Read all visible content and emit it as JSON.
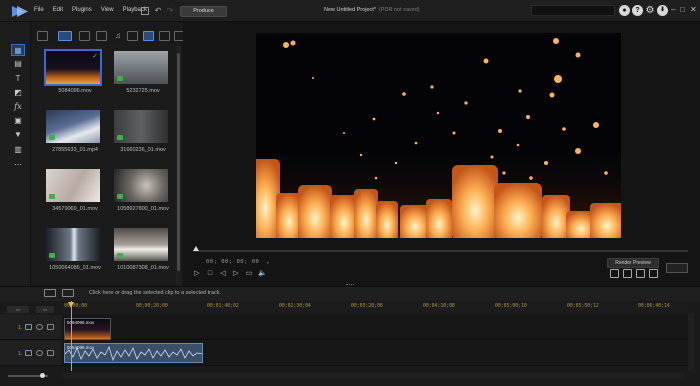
{
  "menu": [
    "File",
    "Edit",
    "Plugins",
    "View",
    "Playback"
  ],
  "toolbar": {
    "produce_label": "Produce",
    "undo_icon": "undo-icon",
    "redo_icon": "redo-icon"
  },
  "project": {
    "title": "New Untitled Project*",
    "status": "(PDR not saved)"
  },
  "header_icons": [
    "account-icon",
    "help-icon",
    "settings-icon",
    "update-icon"
  ],
  "window_controls": [
    "minimize",
    "maximize",
    "close"
  ],
  "tools": [
    "media-room-icon",
    "title-room-icon",
    "text-icon",
    "transition-icon",
    "fx-icon",
    "pip-icon",
    "particle-icon",
    "subtitle-icon",
    "more-icon"
  ],
  "library": {
    "items": [
      {
        "name": "5084096.mov",
        "selected": true
      },
      {
        "name": "5232725.mov"
      },
      {
        "name": "27855633_01.mp4"
      },
      {
        "name": "31660236_01.mov"
      },
      {
        "name": "34579069_01.mov"
      },
      {
        "name": "1058927800_01.mov"
      },
      {
        "name": "1050064086_01.mov"
      },
      {
        "name": "1010087308_01.mov"
      }
    ]
  },
  "preview": {
    "timecode": "00; 00; 00; 00",
    "timecode_mark": "⌄",
    "render_label": "Render Preview"
  },
  "timeline": {
    "hint": "Click here or drag the selected clip to a selected track.",
    "ruler": [
      "00;00;00",
      "00;00;20;00",
      "00;01;40;02",
      "00;02;30;04",
      "00;03;20;06",
      "00;04;10;08",
      "00;05;00;10",
      "00;05;50;12",
      "00;06;40;14"
    ],
    "tracks": [
      {
        "number": "1."
      },
      {
        "number": "1."
      }
    ],
    "video_clip": "5084096.mov",
    "audio_clip": "5084096.mov"
  },
  "colors": {
    "accent": "#3e6ad0",
    "playhead": "#d5a735",
    "audio_clip": "#3a4f6a"
  }
}
